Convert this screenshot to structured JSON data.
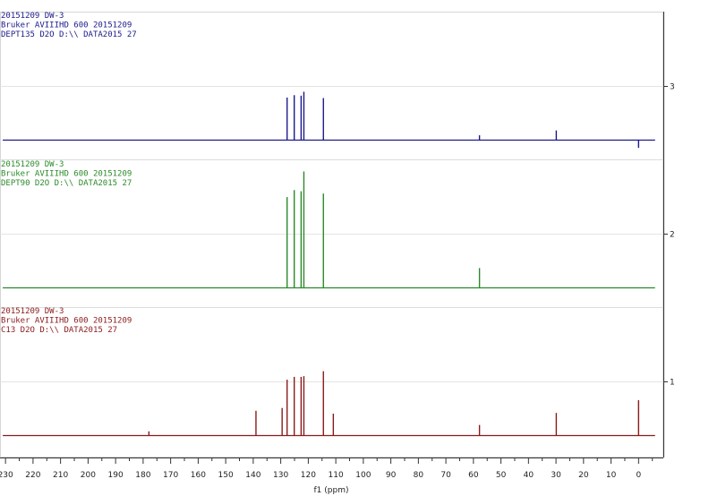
{
  "chart_data": {
    "type": "line",
    "xlabel": "f1 (ppm)",
    "xlim": [
      232,
      -9
    ],
    "x_reversed": true,
    "x_ticks": [
      230,
      220,
      210,
      200,
      190,
      180,
      170,
      160,
      150,
      140,
      130,
      120,
      110,
      100,
      90,
      80,
      70,
      60,
      50,
      40,
      30,
      20,
      10,
      0
    ],
    "y_ticks": [
      1,
      2,
      3
    ],
    "spectra": [
      {
        "index": 3,
        "color": "#1a1a8c",
        "header": [
          "20151209 DW-3",
          "Bruker AVIIIHD 600 20151209",
          "DEPT135 D2O D:\\\\ DATA2015 27"
        ],
        "peaks": [
          {
            "ppm": 127.7,
            "height": 0.88
          },
          {
            "ppm": 125.1,
            "height": 0.93
          },
          {
            "ppm": 122.6,
            "height": 0.92
          },
          {
            "ppm": 121.6,
            "height": 1.0
          },
          {
            "ppm": 114.5,
            "height": 0.87
          },
          {
            "ppm": 57.8,
            "height": 0.1
          },
          {
            "ppm": 29.9,
            "height": 0.2
          },
          {
            "ppm": 0.0,
            "height": -0.16
          }
        ]
      },
      {
        "index": 2,
        "color": "#2a8a2a",
        "header": [
          "20151209 DW-3",
          "Bruker AVIIIHD 600 20151209",
          "DEPT90 D2O D:\\\\ DATA2015 27"
        ],
        "peaks": [
          {
            "ppm": 127.7,
            "height": 0.78
          },
          {
            "ppm": 125.1,
            "height": 0.84
          },
          {
            "ppm": 122.6,
            "height": 0.83
          },
          {
            "ppm": 121.6,
            "height": 1.0
          },
          {
            "ppm": 114.5,
            "height": 0.81
          },
          {
            "ppm": 57.8,
            "height": 0.17
          }
        ]
      },
      {
        "index": 1,
        "color": "#8b1a1a",
        "header": [
          "20151209 DW-3",
          "Bruker AVIIIHD 600 20151209",
          "C13 D2O D:\\\\ DATA2015 27"
        ],
        "peaks": [
          {
            "ppm": 177.9,
            "height": 0.06
          },
          {
            "ppm": 139.0,
            "height": 0.35
          },
          {
            "ppm": 129.5,
            "height": 0.39
          },
          {
            "ppm": 127.7,
            "height": 0.79
          },
          {
            "ppm": 125.1,
            "height": 0.83
          },
          {
            "ppm": 122.6,
            "height": 0.83
          },
          {
            "ppm": 121.6,
            "height": 0.84
          },
          {
            "ppm": 114.5,
            "height": 0.91
          },
          {
            "ppm": 110.9,
            "height": 0.31
          },
          {
            "ppm": 57.8,
            "height": 0.15
          },
          {
            "ppm": 29.9,
            "height": 0.32
          },
          {
            "ppm": 0.0,
            "height": 0.5
          }
        ]
      }
    ]
  }
}
